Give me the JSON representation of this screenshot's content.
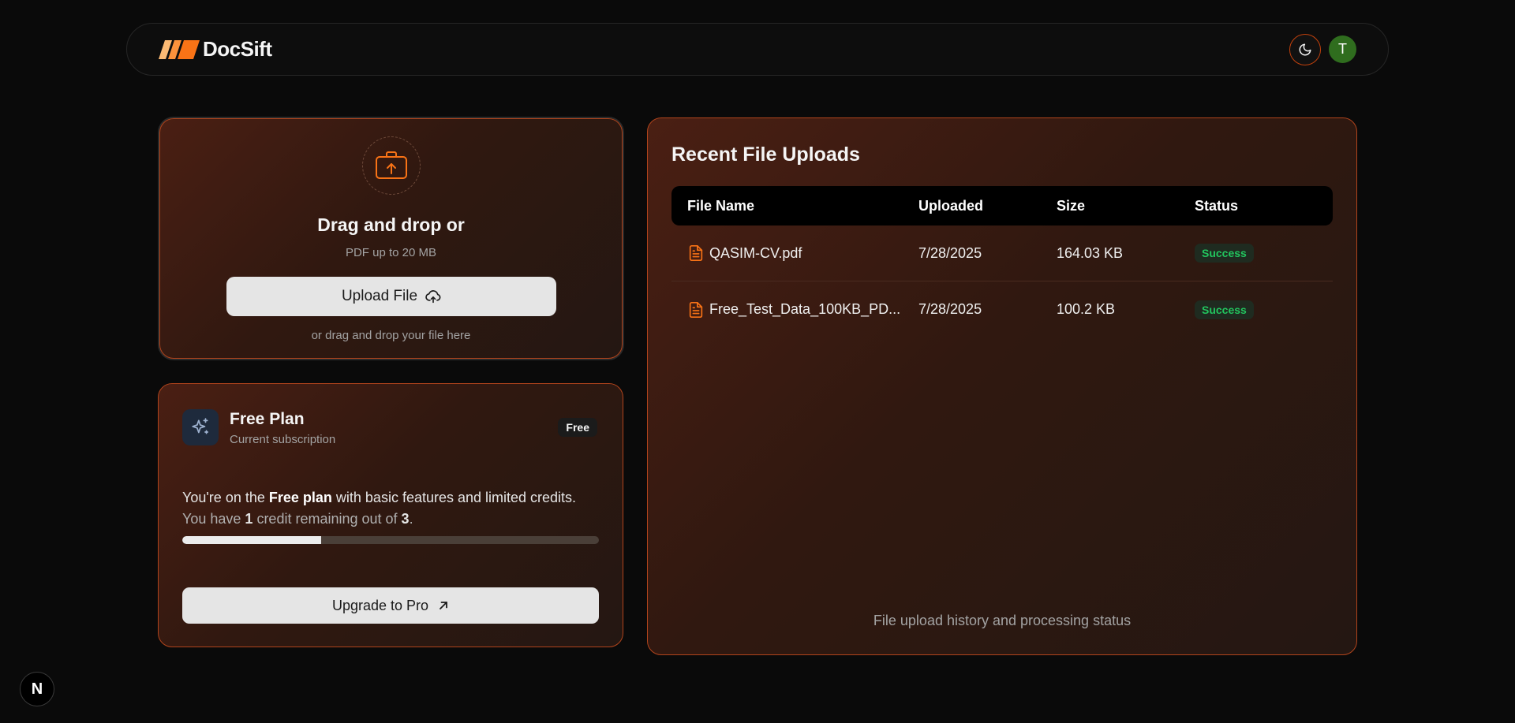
{
  "header": {
    "brand_name": "DocSift",
    "brand_color": "#f97316",
    "theme_toggle_icon": "moon-icon",
    "avatar_initial": "T",
    "avatar_color": "#2f6d1e"
  },
  "upload": {
    "icon": "briefcase-upload-icon",
    "title": "Drag and drop or",
    "subtitle": "PDF up to 20 MB",
    "button_label": "Upload File",
    "button_icon": "cloud-upload-icon",
    "hint": "or drag and drop your file here"
  },
  "plan": {
    "icon": "sparkles-icon",
    "name": "Free Plan",
    "subtitle": "Current subscription",
    "badge": "Free",
    "desc_prefix": "You're on the ",
    "desc_bold": "Free plan",
    "desc_suffix": " with basic features and limited credits.",
    "credits_prefix": "You have ",
    "credits_remaining": "1",
    "credits_middle": " credit remaining out of ",
    "credits_total": "3",
    "credits_suffix": ".",
    "progress_fraction": 0.3333,
    "upgrade_label": "Upgrade to Pro",
    "upgrade_icon": "arrow-up-right-icon"
  },
  "recent": {
    "title": "Recent File Uploads",
    "columns": [
      "File Name",
      "Uploaded",
      "Size",
      "Status"
    ],
    "rows": [
      {
        "name": "QASIM-CV.pdf",
        "uploaded": "7/28/2025",
        "size": "164.03 KB",
        "status": "Success"
      },
      {
        "name": "Free_Test_Data_100KB_PD...",
        "uploaded": "7/28/2025",
        "size": "100.2 KB",
        "status": "Success"
      }
    ],
    "file_icon": "file-text-icon",
    "status_color": "#22c55e",
    "footer": "File upload history and processing status"
  },
  "next_badge": "N"
}
